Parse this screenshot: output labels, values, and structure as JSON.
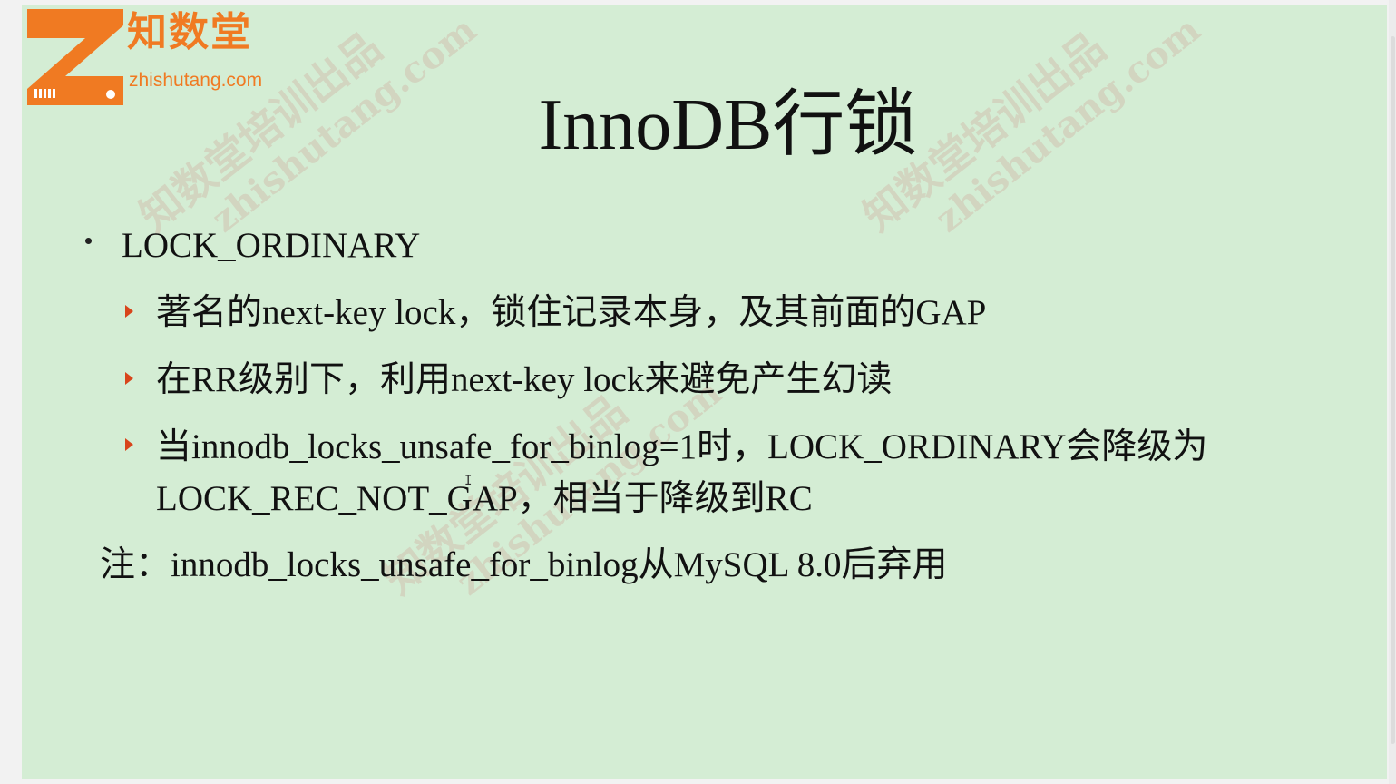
{
  "logo": {
    "brand": "知数堂",
    "domain": "zhishutang.com"
  },
  "watermark": {
    "line1": "知数堂培训出品",
    "line2": "zhishutang.com"
  },
  "title": "InnoDB行锁",
  "bullet": "LOCK_ORDINARY",
  "sub_items": [
    "著名的next-key lock，锁住记录本身，及其前面的GAP",
    "在RR级别下，利用next-key lock来避免产生幻读",
    "当innodb_locks_unsafe_for_binlog=1时，LOCK_ORDINARY会降级为LOCK_REC_NOT_GAP，相当于降级到RC"
  ],
  "note": "注：innodb_locks_unsafe_for_binlog从MySQL 8.0后弃用",
  "colors": {
    "slide_bg": "#d4edd4",
    "brand_orange": "#f07a22",
    "arrow_red": "#d8451b",
    "text": "#111111"
  },
  "icons": {
    "logo": "zhishutang-z-logo",
    "sub_bullet": "triangle-right-icon",
    "main_bullet": "dot-icon"
  }
}
